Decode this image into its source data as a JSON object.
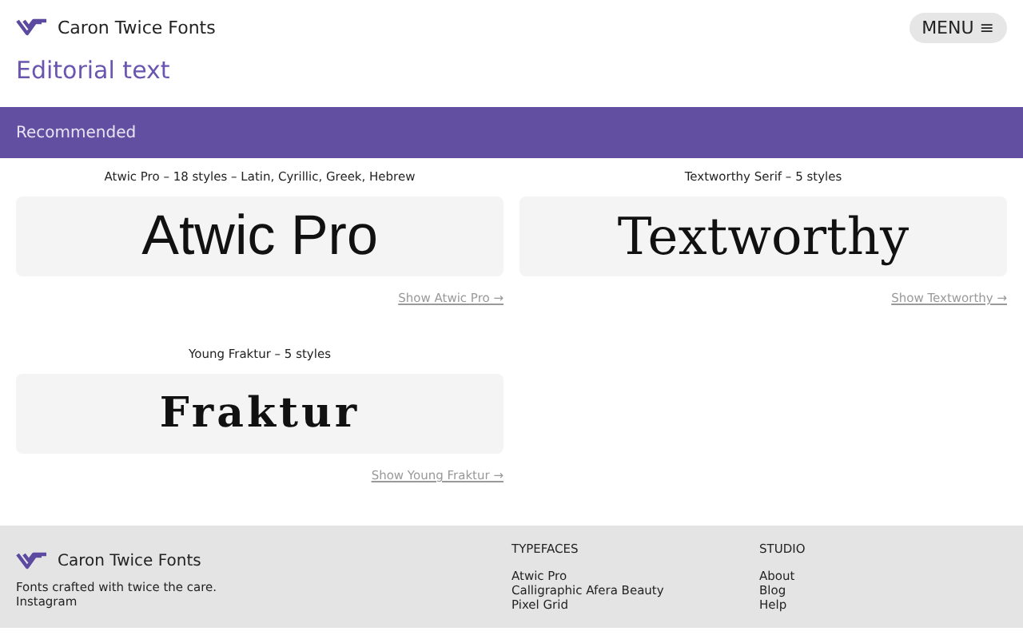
{
  "header": {
    "brand": "Caron Twice Fonts",
    "menu_button": "MENU ≡"
  },
  "page_title": "Editorial text",
  "section_band": "Recommended",
  "fonts": [
    {
      "caption": "Atwic Pro – 18 styles – Latin, Cyrillic, Greek, Hebrew",
      "sample": "Atwic Pro",
      "kind": "sans",
      "link": "Show Atwic Pro →"
    },
    {
      "caption": "Textworthy Serif – 5 styles",
      "sample": "Textworthy",
      "kind": "serif",
      "link": "Show Textworthy →"
    },
    {
      "caption": "Young Fraktur – 5 styles",
      "sample": "Fraktur",
      "kind": "blackletter",
      "link": "Show Young Fraktur →"
    }
  ],
  "footer": {
    "brand": "Caron Twice Fonts",
    "tagline": "Fonts crafted with twice the care.",
    "social": [
      "Instagram"
    ],
    "columns": [
      {
        "heading": "TYPEFACES",
        "links": [
          "Atwic Pro",
          "Calligraphic Afera Beauty",
          "Pixel Grid"
        ]
      },
      {
        "heading": "STUDIO",
        "links": [
          "About",
          "Blog",
          "Help"
        ]
      }
    ]
  }
}
